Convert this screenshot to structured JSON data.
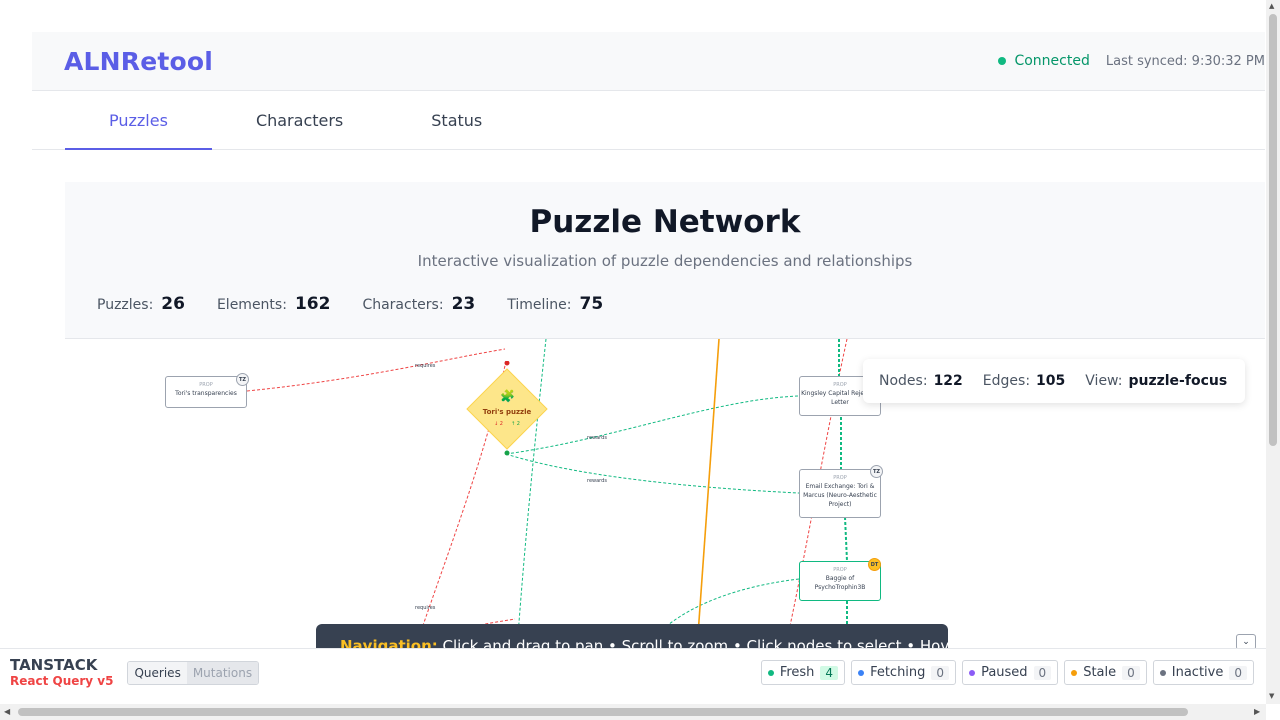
{
  "header": {
    "logo": "ALNRetool",
    "connection": "Connected",
    "last_synced": "Last synced: 9:30:32 PM"
  },
  "tabs": [
    {
      "label": "Puzzles"
    },
    {
      "label": "Characters"
    },
    {
      "label": "Status"
    }
  ],
  "panel": {
    "title": "Puzzle Network",
    "subtitle": "Interactive visualization of puzzle dependencies and relationships",
    "stats": [
      {
        "label": "Puzzles:",
        "value": "26"
      },
      {
        "label": "Elements:",
        "value": "162"
      },
      {
        "label": "Characters:",
        "value": "23"
      },
      {
        "label": "Timeline:",
        "value": "75"
      }
    ]
  },
  "graph": {
    "overlay": {
      "nodes_label": "Nodes:",
      "nodes": "122",
      "edges_label": "Edges:",
      "edges": "105",
      "view_label": "View:",
      "view": "puzzle-focus"
    },
    "nodes": [
      {
        "type": "PROP",
        "label": "Tori's transparencies",
        "badge": "TZ"
      },
      {
        "type": "PROP",
        "label": "Kingsley Capital Rejection Letter",
        "badge": ""
      },
      {
        "type": "PROP",
        "label": "Email Exchange: Tori & Marcus (Neuro-Aesthetic Project)",
        "badge": "TZ"
      },
      {
        "type": "PROP",
        "label": "Baggie of PsychoTrophin3B",
        "badge": "DT"
      }
    ],
    "puzzle": {
      "label": "Tori's puzzle",
      "in": "↓ 2",
      "out": "↑ 2",
      "icon": "puzzle-piece-icon"
    },
    "edge_labels": {
      "requires": "requires",
      "rewards": "rewards"
    },
    "nav_hint": {
      "key": "Navigation:",
      "text": " Click and drag to pan • Scroll to zoom • Click nodes to select • Hover"
    }
  },
  "devtools": {
    "brand_top": "TANSTACK",
    "brand_bottom": "React Query v5",
    "tabs": [
      "Queries",
      "Mutations"
    ],
    "statuses": [
      {
        "label": "Fresh",
        "count": "4",
        "color": "#10b981"
      },
      {
        "label": "Fetching",
        "count": "0",
        "color": "#3b82f6"
      },
      {
        "label": "Paused",
        "count": "0",
        "color": "#8b5cf6"
      },
      {
        "label": "Stale",
        "count": "0",
        "color": "#f59e0b"
      },
      {
        "label": "Inactive",
        "count": "0",
        "color": "#6b7280"
      }
    ]
  },
  "colors": {
    "accent": "#5b5ee6",
    "requires_edge": "#ef4444",
    "rewards_edge": "#10b981"
  }
}
